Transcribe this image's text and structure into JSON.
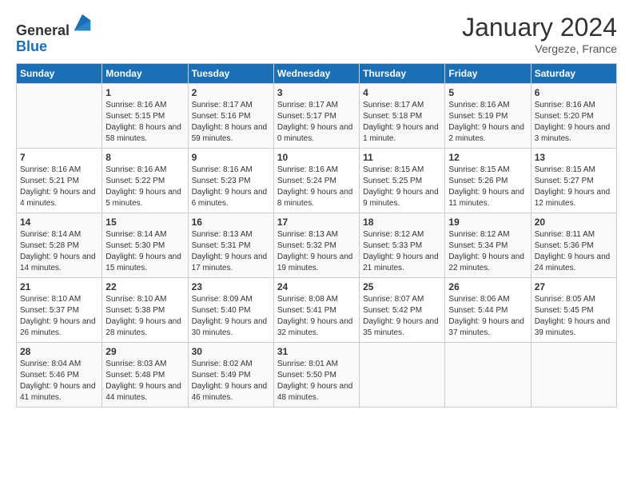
{
  "header": {
    "logo_line1": "General",
    "logo_line2": "Blue",
    "month_title": "January 2024",
    "location": "Vergeze, France"
  },
  "days_of_week": [
    "Sunday",
    "Monday",
    "Tuesday",
    "Wednesday",
    "Thursday",
    "Friday",
    "Saturday"
  ],
  "weeks": [
    [
      {
        "day": "",
        "sunrise": "",
        "sunset": "",
        "daylight": ""
      },
      {
        "day": "1",
        "sunrise": "Sunrise: 8:16 AM",
        "sunset": "Sunset: 5:15 PM",
        "daylight": "Daylight: 8 hours and 58 minutes."
      },
      {
        "day": "2",
        "sunrise": "Sunrise: 8:17 AM",
        "sunset": "Sunset: 5:16 PM",
        "daylight": "Daylight: 8 hours and 59 minutes."
      },
      {
        "day": "3",
        "sunrise": "Sunrise: 8:17 AM",
        "sunset": "Sunset: 5:17 PM",
        "daylight": "Daylight: 9 hours and 0 minutes."
      },
      {
        "day": "4",
        "sunrise": "Sunrise: 8:17 AM",
        "sunset": "Sunset: 5:18 PM",
        "daylight": "Daylight: 9 hours and 1 minute."
      },
      {
        "day": "5",
        "sunrise": "Sunrise: 8:16 AM",
        "sunset": "Sunset: 5:19 PM",
        "daylight": "Daylight: 9 hours and 2 minutes."
      },
      {
        "day": "6",
        "sunrise": "Sunrise: 8:16 AM",
        "sunset": "Sunset: 5:20 PM",
        "daylight": "Daylight: 9 hours and 3 minutes."
      }
    ],
    [
      {
        "day": "7",
        "sunrise": "Sunrise: 8:16 AM",
        "sunset": "Sunset: 5:21 PM",
        "daylight": "Daylight: 9 hours and 4 minutes."
      },
      {
        "day": "8",
        "sunrise": "Sunrise: 8:16 AM",
        "sunset": "Sunset: 5:22 PM",
        "daylight": "Daylight: 9 hours and 5 minutes."
      },
      {
        "day": "9",
        "sunrise": "Sunrise: 8:16 AM",
        "sunset": "Sunset: 5:23 PM",
        "daylight": "Daylight: 9 hours and 6 minutes."
      },
      {
        "day": "10",
        "sunrise": "Sunrise: 8:16 AM",
        "sunset": "Sunset: 5:24 PM",
        "daylight": "Daylight: 9 hours and 8 minutes."
      },
      {
        "day": "11",
        "sunrise": "Sunrise: 8:15 AM",
        "sunset": "Sunset: 5:25 PM",
        "daylight": "Daylight: 9 hours and 9 minutes."
      },
      {
        "day": "12",
        "sunrise": "Sunrise: 8:15 AM",
        "sunset": "Sunset: 5:26 PM",
        "daylight": "Daylight: 9 hours and 11 minutes."
      },
      {
        "day": "13",
        "sunrise": "Sunrise: 8:15 AM",
        "sunset": "Sunset: 5:27 PM",
        "daylight": "Daylight: 9 hours and 12 minutes."
      }
    ],
    [
      {
        "day": "14",
        "sunrise": "Sunrise: 8:14 AM",
        "sunset": "Sunset: 5:28 PM",
        "daylight": "Daylight: 9 hours and 14 minutes."
      },
      {
        "day": "15",
        "sunrise": "Sunrise: 8:14 AM",
        "sunset": "Sunset: 5:30 PM",
        "daylight": "Daylight: 9 hours and 15 minutes."
      },
      {
        "day": "16",
        "sunrise": "Sunrise: 8:13 AM",
        "sunset": "Sunset: 5:31 PM",
        "daylight": "Daylight: 9 hours and 17 minutes."
      },
      {
        "day": "17",
        "sunrise": "Sunrise: 8:13 AM",
        "sunset": "Sunset: 5:32 PM",
        "daylight": "Daylight: 9 hours and 19 minutes."
      },
      {
        "day": "18",
        "sunrise": "Sunrise: 8:12 AM",
        "sunset": "Sunset: 5:33 PM",
        "daylight": "Daylight: 9 hours and 21 minutes."
      },
      {
        "day": "19",
        "sunrise": "Sunrise: 8:12 AM",
        "sunset": "Sunset: 5:34 PM",
        "daylight": "Daylight: 9 hours and 22 minutes."
      },
      {
        "day": "20",
        "sunrise": "Sunrise: 8:11 AM",
        "sunset": "Sunset: 5:36 PM",
        "daylight": "Daylight: 9 hours and 24 minutes."
      }
    ],
    [
      {
        "day": "21",
        "sunrise": "Sunrise: 8:10 AM",
        "sunset": "Sunset: 5:37 PM",
        "daylight": "Daylight: 9 hours and 26 minutes."
      },
      {
        "day": "22",
        "sunrise": "Sunrise: 8:10 AM",
        "sunset": "Sunset: 5:38 PM",
        "daylight": "Daylight: 9 hours and 28 minutes."
      },
      {
        "day": "23",
        "sunrise": "Sunrise: 8:09 AM",
        "sunset": "Sunset: 5:40 PM",
        "daylight": "Daylight: 9 hours and 30 minutes."
      },
      {
        "day": "24",
        "sunrise": "Sunrise: 8:08 AM",
        "sunset": "Sunset: 5:41 PM",
        "daylight": "Daylight: 9 hours and 32 minutes."
      },
      {
        "day": "25",
        "sunrise": "Sunrise: 8:07 AM",
        "sunset": "Sunset: 5:42 PM",
        "daylight": "Daylight: 9 hours and 35 minutes."
      },
      {
        "day": "26",
        "sunrise": "Sunrise: 8:06 AM",
        "sunset": "Sunset: 5:44 PM",
        "daylight": "Daylight: 9 hours and 37 minutes."
      },
      {
        "day": "27",
        "sunrise": "Sunrise: 8:05 AM",
        "sunset": "Sunset: 5:45 PM",
        "daylight": "Daylight: 9 hours and 39 minutes."
      }
    ],
    [
      {
        "day": "28",
        "sunrise": "Sunrise: 8:04 AM",
        "sunset": "Sunset: 5:46 PM",
        "daylight": "Daylight: 9 hours and 41 minutes."
      },
      {
        "day": "29",
        "sunrise": "Sunrise: 8:03 AM",
        "sunset": "Sunset: 5:48 PM",
        "daylight": "Daylight: 9 hours and 44 minutes."
      },
      {
        "day": "30",
        "sunrise": "Sunrise: 8:02 AM",
        "sunset": "Sunset: 5:49 PM",
        "daylight": "Daylight: 9 hours and 46 minutes."
      },
      {
        "day": "31",
        "sunrise": "Sunrise: 8:01 AM",
        "sunset": "Sunset: 5:50 PM",
        "daylight": "Daylight: 9 hours and 48 minutes."
      },
      {
        "day": "",
        "sunrise": "",
        "sunset": "",
        "daylight": ""
      },
      {
        "day": "",
        "sunrise": "",
        "sunset": "",
        "daylight": ""
      },
      {
        "day": "",
        "sunrise": "",
        "sunset": "",
        "daylight": ""
      }
    ]
  ]
}
